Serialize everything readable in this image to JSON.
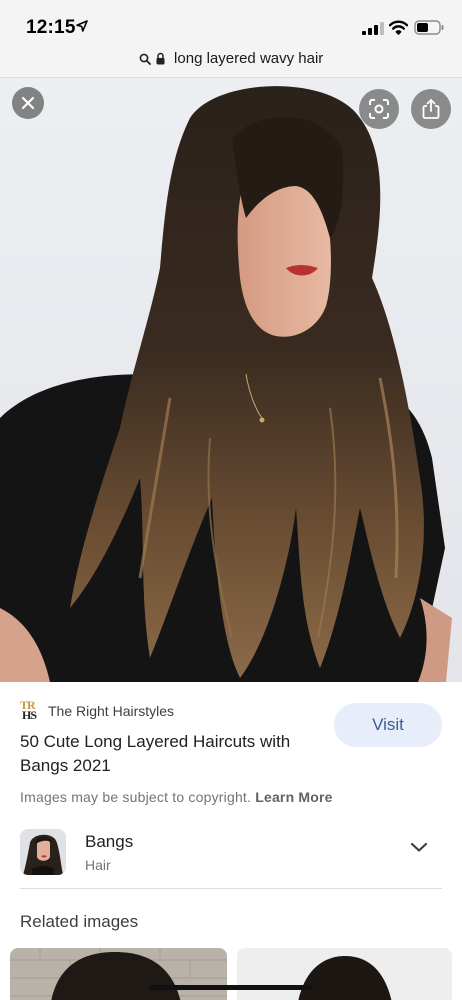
{
  "status_bar": {
    "time": "12:15"
  },
  "url_bar": {
    "query": "long layered wavy hair"
  },
  "result": {
    "source_logo_text": [
      "TR",
      "HS"
    ],
    "source_name": "The Right Hairstyles",
    "visit_label": "Visit",
    "title": "50 Cute Long Layered Haircuts with Bangs 2021",
    "copyright_text": "Images may be subject to copyright.",
    "learn_more": "Learn More"
  },
  "topic": {
    "title": "Bangs",
    "subtitle": "Hair"
  },
  "related_heading": "Related images",
  "colors": {
    "visit_bg": "#e8eef9",
    "visit_text": "#3b5b9a",
    "photo_bg": "#ebecef"
  },
  "icons": [
    "location-arrow-icon",
    "signal-icon",
    "wifi-icon",
    "battery-icon",
    "search-icon",
    "lock-icon",
    "close-icon",
    "lens-icon",
    "share-icon",
    "chevron-down-icon"
  ]
}
